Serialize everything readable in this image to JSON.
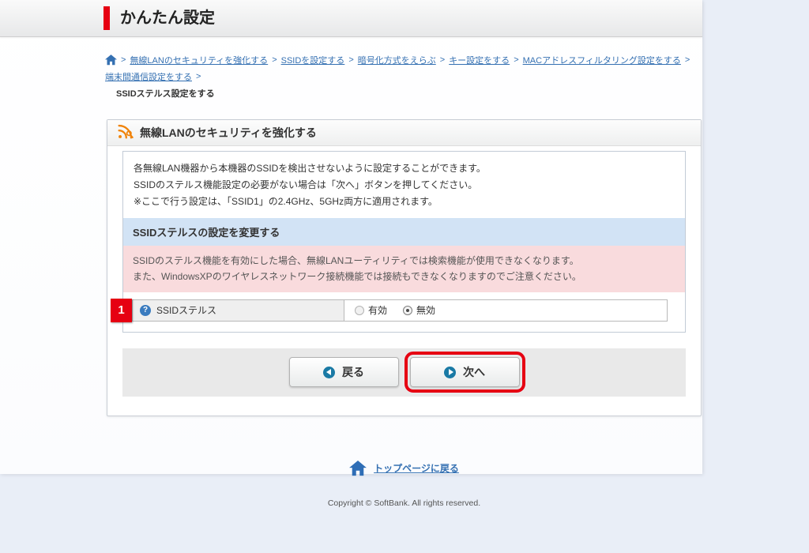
{
  "header": {
    "title": "かんたん設定"
  },
  "breadcrumb": {
    "separator": ">",
    "items": [
      {
        "label": "無線LANのセキュリティを強化する"
      },
      {
        "label": "SSIDを設定する"
      },
      {
        "label": "暗号化方式をえらぶ"
      },
      {
        "label": "キー設定をする"
      },
      {
        "label": "MACアドレスフィルタリング設定をする"
      },
      {
        "label": "端末間通信設定をする"
      }
    ],
    "current": "SSIDステルス設定をする"
  },
  "panel": {
    "title": "無線LANのセキュリティを強化する",
    "description_lines": [
      "各無線LAN機器から本機器のSSIDを検出させないように設定することができます。",
      "SSIDのステルス機能設定の必要がない場合は「次へ」ボタンを押してください。",
      "※ここで行う設定は、「SSID1」の2.4GHz、5GHz両方に適用されます。"
    ],
    "section_title": "SSIDステルスの設定を変更する",
    "warning_lines": [
      "SSIDのステルス機能を有効にした場合、無線LANユーティリティでは検索機能が使用できなくなります。",
      "また、WindowsXPのワイヤレスネットワーク接続機能では接続もできなくなりますのでご注意ください。"
    ],
    "row": {
      "step_number": "1",
      "label": "SSIDステルス",
      "options": [
        {
          "label": "有効",
          "selected": false
        },
        {
          "label": "無効",
          "selected": true
        }
      ]
    },
    "buttons": {
      "back": "戻る",
      "next": "次へ"
    }
  },
  "footer": {
    "top_link": "トップページに戻る",
    "copyright": "Copyright © SoftBank. All rights reserved."
  },
  "icons": {
    "help_glyph": "?"
  },
  "colors": {
    "accent_red": "#e60012",
    "link_blue": "#3470b2",
    "section_bg": "#d2e3f5",
    "warning_bg": "#f9dbdd",
    "wireless_orange": "#f0830a",
    "button_icon_blue": "#1a7aa5"
  }
}
